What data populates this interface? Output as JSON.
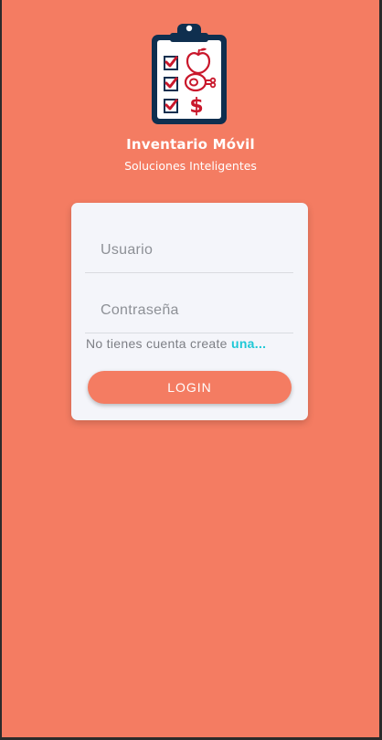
{
  "app": {
    "title": "Inventario Móvil",
    "subtitle": "Soluciones Inteligentes"
  },
  "logo": {
    "icon": "clipboard-checklist-icon",
    "price_symbol": "$"
  },
  "form": {
    "username_placeholder": "Usuario",
    "password_placeholder": "Contraseña",
    "username_value": "",
    "password_value": "",
    "signup_text": "No tienes cuenta create ",
    "signup_link": "una...",
    "login_label": "LOGIN"
  },
  "colors": {
    "background": "#f47c62",
    "card": "#f4f5fa",
    "link": "#1ec8d6",
    "logo_navy": "#0f2f4f",
    "check_red": "#c9172b"
  }
}
